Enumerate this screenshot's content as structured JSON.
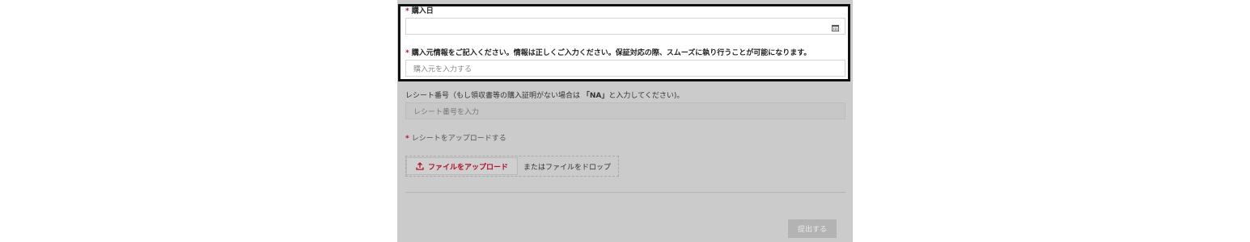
{
  "form": {
    "purchase_date": {
      "label": "購入日",
      "required_mark": "*",
      "calendar_icon": "calendar-icon"
    },
    "purchase_source": {
      "label": "購入元情報をご記入ください。情報は正しくご入力ください。保証対応の際、スムーズに執り行うことが可能になります。",
      "required_mark": "*",
      "placeholder": "購入元を入力する"
    },
    "receipt_number": {
      "label_prefix": "レシート番号（もし領収書等の購入証明がない場合は ",
      "label_emphasis": "「NA」",
      "label_suffix": "と入力してください)。",
      "placeholder": "レシート番号を入力"
    },
    "receipt_upload": {
      "label": "レシートをアップロードする",
      "required_mark": "*",
      "button_label": "ファイルをアップロード",
      "upload_icon": "upload-icon",
      "drop_text": "またはファイルをドロップ"
    },
    "submit_label": "提出する"
  },
  "colors": {
    "required": "#c0102a",
    "panel_background": "#cbcbcb",
    "highlight_border": "#111111",
    "submit_background": "#b3b3b3"
  }
}
